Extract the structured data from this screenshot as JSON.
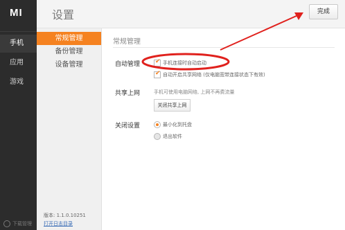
{
  "app": {
    "logo": "MI",
    "title": "设置"
  },
  "rail": {
    "items": [
      {
        "label": "手机",
        "active": true
      },
      {
        "label": "应用",
        "active": false
      },
      {
        "label": "游戏",
        "active": false
      }
    ],
    "footer": "下载管理"
  },
  "header": {
    "done_label": "完成"
  },
  "subnav": {
    "items": [
      {
        "label": "常规管理",
        "active": true
      },
      {
        "label": "备份管理",
        "active": false
      },
      {
        "label": "设备管理",
        "active": false
      }
    ],
    "version": "版本: 1.1.0.10251",
    "log_link": "打开日志目录"
  },
  "content": {
    "section_title": "常规管理",
    "auto": {
      "label": "自动管理",
      "options": [
        {
          "text": "手机连接时自动启动",
          "checked": true
        },
        {
          "text": "自动开启共享网络 (仅电脑宽带连接状态下有效)",
          "checked": true
        }
      ]
    },
    "share": {
      "label": "共享上网",
      "description": "手机可使用电脑网络, 上网不再费流量",
      "button": "关闭共享上网"
    },
    "close": {
      "label": "关闭设置",
      "options": [
        {
          "text": "最小化到托盘",
          "selected": true
        },
        {
          "text": "退出软件",
          "selected": false
        }
      ]
    }
  },
  "colors": {
    "accent": "#f58220",
    "annotation": "#e0211d",
    "rail_bg": "#2c2c2c"
  }
}
